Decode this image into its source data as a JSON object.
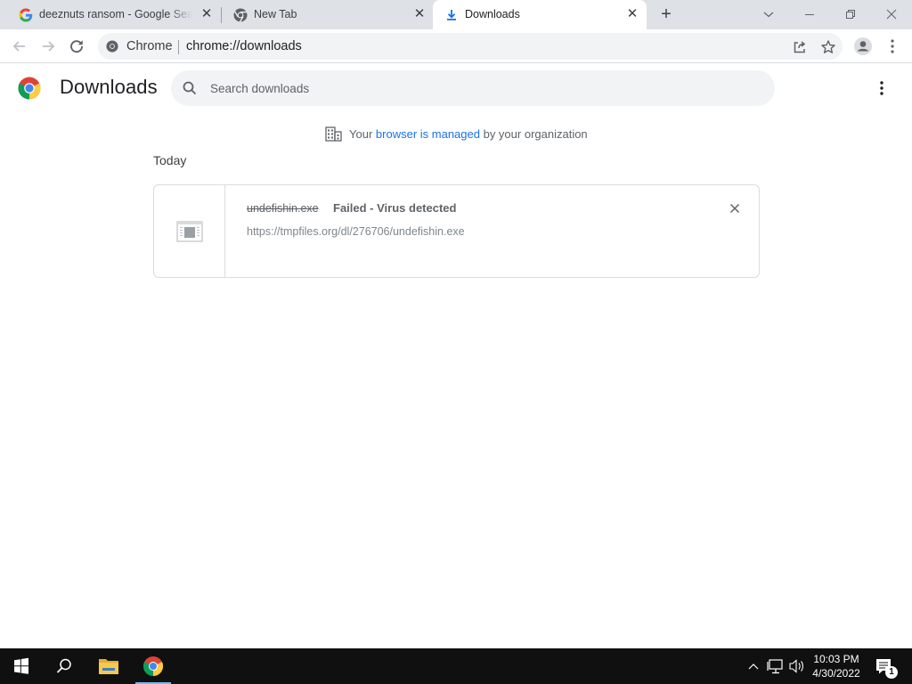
{
  "browser": {
    "tabs": [
      {
        "title": "deeznuts ransom - Google Search",
        "favicon": "google-g-icon",
        "active": false
      },
      {
        "title": "New Tab",
        "favicon": "chrome-icon",
        "active": false
      },
      {
        "title": "Downloads",
        "favicon": "download-icon",
        "active": true
      }
    ],
    "omnibox": {
      "site_label": "Chrome",
      "url": "chrome://downloads"
    }
  },
  "page": {
    "title": "Downloads",
    "search_placeholder": "Search downloads",
    "managed": {
      "prefix": "Your",
      "link": "browser is managed",
      "suffix": "by your organization"
    },
    "date_heading": "Today",
    "downloads": [
      {
        "file_name": "undefishin.exe",
        "status": "Failed - Virus detected",
        "url": "https://tmpfiles.org/dl/276706/undefishin.exe"
      }
    ]
  },
  "taskbar": {
    "time": "10:03 PM",
    "date": "4/30/2022",
    "notification_count": "1"
  },
  "colors": {
    "link": "#1a73e8",
    "tabstrip": "#dee1e6",
    "taskbar": "#101010"
  }
}
